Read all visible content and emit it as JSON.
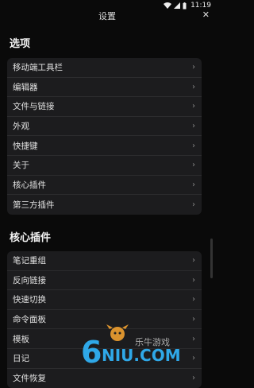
{
  "status": {
    "time": "11:19"
  },
  "header": {
    "title": "设置",
    "close": "✕"
  },
  "sections": [
    {
      "title": "选项",
      "items": [
        "移动端工具栏",
        "编辑器",
        "文件与链接",
        "外观",
        "快捷键",
        "关于",
        "核心插件",
        "第三方插件"
      ]
    },
    {
      "title": "核心插件",
      "items": [
        "笔记重组",
        "反向链接",
        "快速切换",
        "命令面板",
        "模板",
        "日记",
        "文件恢复"
      ]
    }
  ],
  "watermark": {
    "brand_number": "6",
    "brand_text": "NIU.COM",
    "brand_cn": "乐牛游戏"
  }
}
